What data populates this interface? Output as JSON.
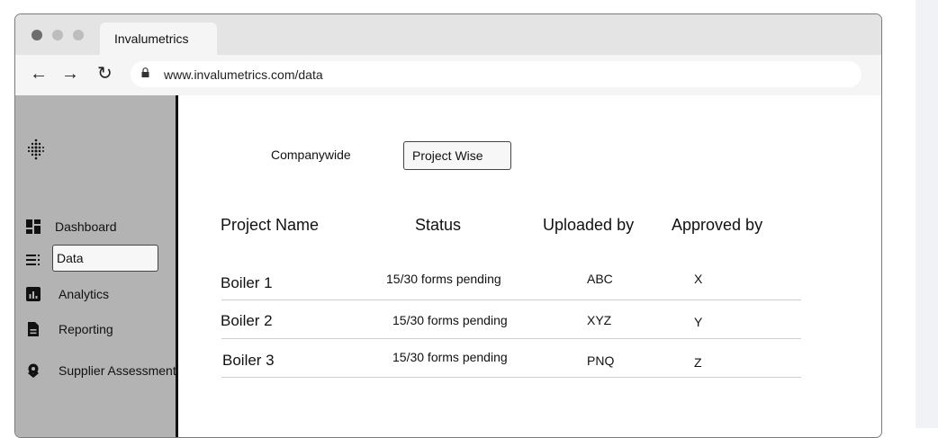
{
  "browser": {
    "tab_title": "Invalumetrics",
    "url": "www.invalumetrics.com/data"
  },
  "sidebar": {
    "items": [
      {
        "label": "Dashboard",
        "icon": "dashboard-icon"
      },
      {
        "label": "Data",
        "icon": "data-list-icon"
      },
      {
        "label": "Analytics",
        "icon": "analytics-icon"
      },
      {
        "label": "Reporting",
        "icon": "document-icon"
      },
      {
        "label": "Supplier Assessment",
        "icon": "badge-icon"
      }
    ]
  },
  "view_toggle": {
    "companywide": "Companywide",
    "project_wise": "Project Wise"
  },
  "table": {
    "headers": [
      "Project Name",
      "Status",
      "Uploaded by",
      "Approved by"
    ],
    "rows": [
      {
        "name": "Boiler 1",
        "status": "15/30 forms pending",
        "uploaded_by": "ABC",
        "approved_by": "X"
      },
      {
        "name": "Boiler 2",
        "status": "15/30 forms pending",
        "uploaded_by": "XYZ",
        "approved_by": "Y"
      },
      {
        "name": "Boiler 3",
        "status": "15/30 forms pending",
        "uploaded_by": "PNQ",
        "approved_by": "Z"
      }
    ]
  },
  "colors": {
    "sidebar_bg": "#b3b3b3",
    "tabbar_bg": "#e4e4e4"
  }
}
